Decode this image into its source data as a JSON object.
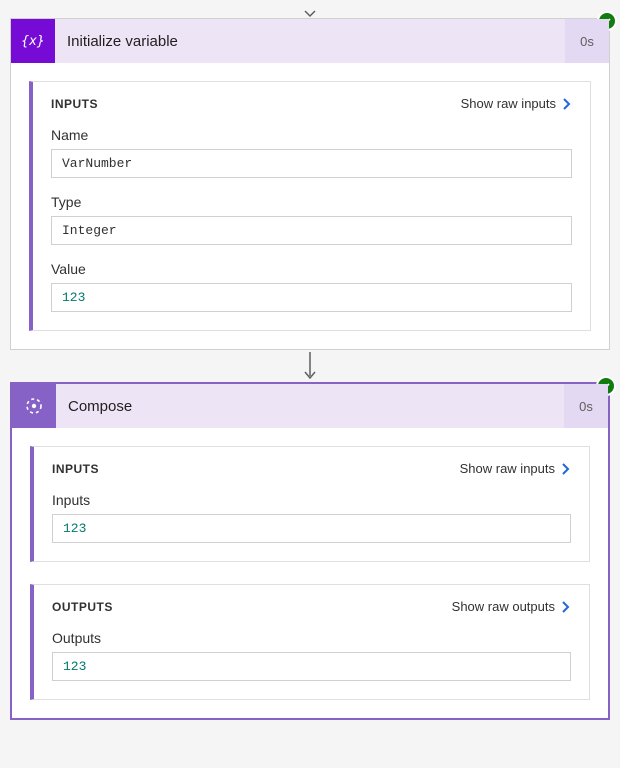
{
  "actions": {
    "init_var": {
      "title": "Initialize variable",
      "duration": "0s",
      "panels": {
        "inputs": {
          "title": "INPUTS",
          "raw_link": "Show raw inputs",
          "fields": {
            "name": {
              "label": "Name",
              "value": "VarNumber"
            },
            "type": {
              "label": "Type",
              "value": "Integer"
            },
            "value": {
              "label": "Value",
              "value": "123"
            }
          }
        }
      }
    },
    "compose": {
      "title": "Compose",
      "duration": "0s",
      "panels": {
        "inputs": {
          "title": "INPUTS",
          "raw_link": "Show raw inputs",
          "fields": {
            "inputs": {
              "label": "Inputs",
              "value": "123"
            }
          }
        },
        "outputs": {
          "title": "OUTPUTS",
          "raw_link": "Show raw outputs",
          "fields": {
            "outputs": {
              "label": "Outputs",
              "value": "123"
            }
          }
        }
      }
    }
  }
}
